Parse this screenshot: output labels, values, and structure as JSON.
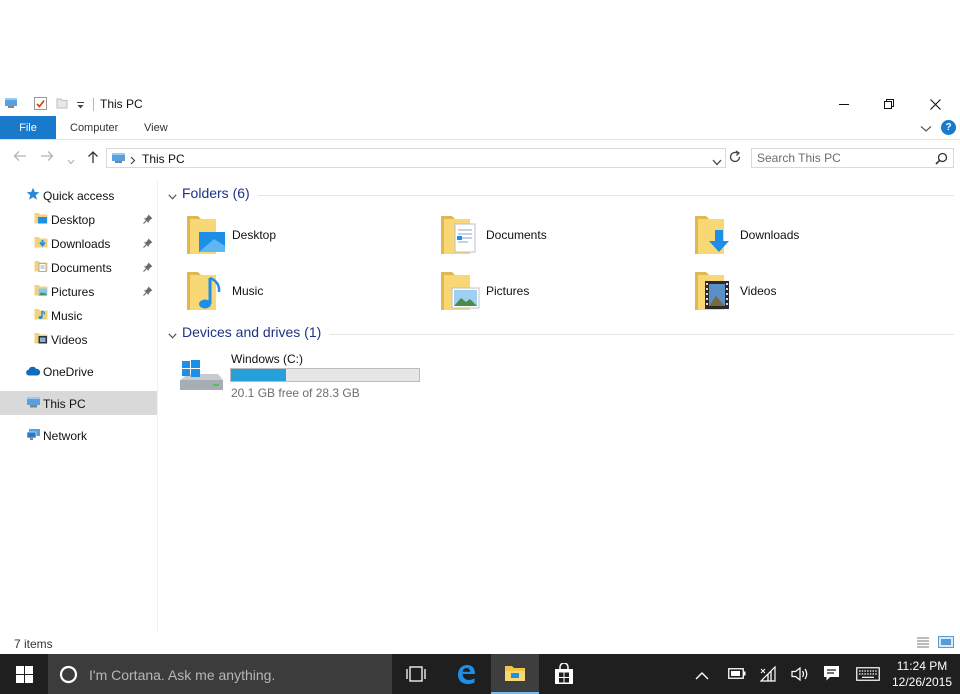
{
  "window": {
    "title": "This PC",
    "controls": {
      "minimize": "minimize",
      "restore": "restore",
      "close": "close"
    }
  },
  "ribbon": {
    "tabs": [
      "File",
      "Computer",
      "View"
    ],
    "help_label": "?"
  },
  "address": {
    "path": "This PC",
    "search_placeholder": "Search This PC"
  },
  "nav": {
    "quick_access": "Quick access",
    "pinned": [
      {
        "label": "Desktop",
        "icon": "desktop-icon",
        "pinned": true
      },
      {
        "label": "Downloads",
        "icon": "downloads-icon",
        "pinned": true
      },
      {
        "label": "Documents",
        "icon": "documents-icon",
        "pinned": true
      },
      {
        "label": "Pictures",
        "icon": "pictures-icon",
        "pinned": true
      },
      {
        "label": "Music",
        "icon": "music-icon",
        "pinned": false
      },
      {
        "label": "Videos",
        "icon": "videos-icon",
        "pinned": false
      }
    ],
    "onedrive": "OneDrive",
    "this_pc": "This PC",
    "network": "Network",
    "selected": "This PC"
  },
  "content": {
    "folders_header": "Folders (6)",
    "folders": [
      {
        "name": "Desktop",
        "icon": "desktop-folder-icon"
      },
      {
        "name": "Documents",
        "icon": "documents-folder-icon"
      },
      {
        "name": "Downloads",
        "icon": "downloads-folder-icon"
      },
      {
        "name": "Music",
        "icon": "music-folder-icon"
      },
      {
        "name": "Pictures",
        "icon": "pictures-folder-icon"
      },
      {
        "name": "Videos",
        "icon": "videos-folder-icon"
      }
    ],
    "drives_header": "Devices and drives (1)",
    "drives": [
      {
        "name": "Windows (C:)",
        "free_text": "20.1 GB free of 28.3 GB",
        "used_fraction": 0.29
      }
    ]
  },
  "status": {
    "items_text": "7 items"
  },
  "taskbar": {
    "cortana_placeholder": "I'm Cortana. Ask me anything.",
    "apps": [
      "task-view",
      "edge",
      "file-explorer",
      "store"
    ],
    "active_app": "file-explorer",
    "clock_time": "11:24 PM",
    "clock_date": "12/26/2015"
  },
  "colors": {
    "accent": "#1979ca",
    "group_header": "#1e3287",
    "drive_bar": "#26a0da",
    "folder": "#f3d37a",
    "taskbar": "#1f1f1f"
  }
}
